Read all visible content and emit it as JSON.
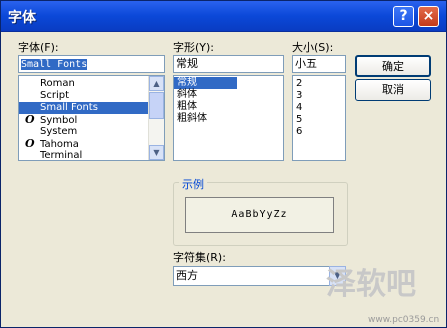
{
  "window": {
    "title": "字体",
    "help_glyph": "?",
    "close_glyph": "×"
  },
  "font": {
    "label": "字体(F):",
    "value": "Small Fonts",
    "items": [
      {
        "name": "Roman",
        "icon": ""
      },
      {
        "name": "Script",
        "icon": ""
      },
      {
        "name": "Small Fonts",
        "icon": ""
      },
      {
        "name": "Symbol",
        "icon": "O"
      },
      {
        "name": "System",
        "icon": ""
      },
      {
        "name": "Tahoma",
        "icon": "O"
      },
      {
        "name": "Terminal",
        "icon": ""
      }
    ]
  },
  "style": {
    "label": "字形(Y):",
    "value": "常规",
    "items": [
      "常规",
      "斜体",
      "粗体",
      "粗斜体"
    ]
  },
  "size": {
    "label": "大小(S):",
    "value": "小五",
    "items": [
      "2",
      "3",
      "4",
      "5",
      "6"
    ]
  },
  "buttons": {
    "ok": "确定",
    "cancel": "取消"
  },
  "sample": {
    "label": "示例",
    "text": "AaBbYyZz"
  },
  "charset": {
    "label": "字符集(R):",
    "value": "西方"
  },
  "scroll": {
    "up_glyph": "▲",
    "down_glyph": "▼"
  },
  "watermark": {
    "text": "泽软吧",
    "url": "www.pc0359.cn"
  }
}
